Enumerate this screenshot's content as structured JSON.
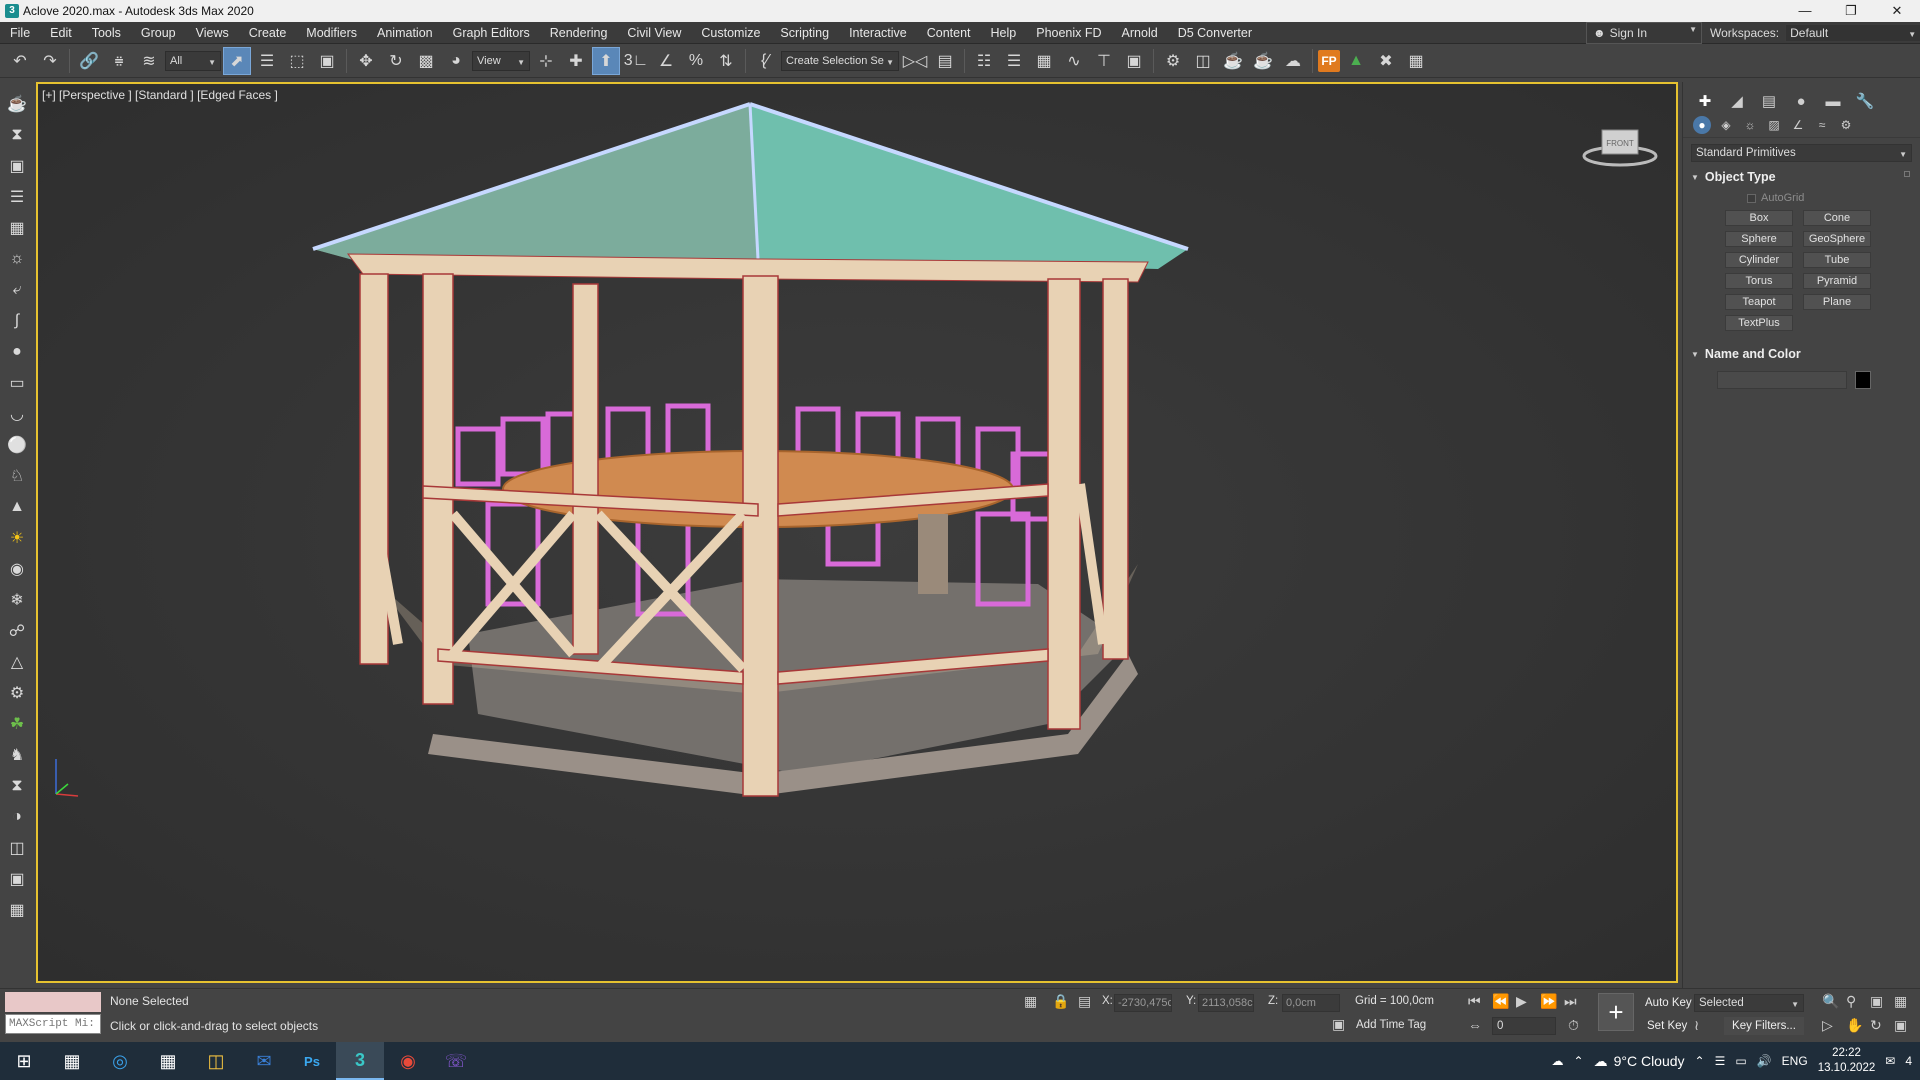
{
  "window": {
    "title": "Aclove 2020.max - Autodesk 3ds Max 2020",
    "minimize": "—",
    "restore": "❐",
    "close": "✕"
  },
  "menu": {
    "items": [
      "File",
      "Edit",
      "Tools",
      "Group",
      "Views",
      "Create",
      "Modifiers",
      "Animation",
      "Graph Editors",
      "Rendering",
      "Civil View",
      "Customize",
      "Scripting",
      "Interactive",
      "Content",
      "Help",
      "Phoenix FD",
      "Arnold",
      "D5 Converter"
    ],
    "sign_in": "Sign In",
    "workspaces_label": "Workspaces:",
    "workspaces_value": "Default"
  },
  "toolbar": {
    "selection_filter": "All",
    "ref_coord": "View",
    "named_selection": "Create Selection Se",
    "fp_label": "FP"
  },
  "viewport": {
    "label": "[+] [Perspective ] [Standard ] [Edged Faces ]",
    "viewcube_label": "FRONT",
    "colors": {
      "frame_wood": "#e8d2b4",
      "roof": "#6fc4b0",
      "chairs": "#d86ad8",
      "table": "#d08a50",
      "floor": "#7a7670"
    }
  },
  "command_panel": {
    "category": "Standard Primitives",
    "object_type_title": "Object Type",
    "autogrid": "AutoGrid",
    "buttons": [
      "Box",
      "Cone",
      "Sphere",
      "GeoSphere",
      "Cylinder",
      "Tube",
      "Torus",
      "Pyramid",
      "Teapot",
      "Plane",
      "TextPlus"
    ],
    "name_color_title": "Name and Color"
  },
  "status": {
    "maxscript": "MAXScript Mi:",
    "selection": "None Selected",
    "prompt": "Click or click-and-drag to select objects",
    "x_label": "X:",
    "x_value": "-2730,475c",
    "y_label": "Y:",
    "y_value": "2113,058c",
    "z_label": "Z:",
    "z_value": "0,0cm",
    "grid": "Grid = 100,0cm",
    "add_time_tag": "Add Time Tag",
    "auto_key": "Auto Key",
    "set_key": "Set Key",
    "key_mode": "Selected",
    "key_filters": "Key Filters...",
    "frame": "0"
  },
  "taskbar": {
    "weather": "9°C  Cloudy",
    "language": "ENG",
    "time": "22:22",
    "date": "13.10.2022",
    "notifications": "4"
  }
}
